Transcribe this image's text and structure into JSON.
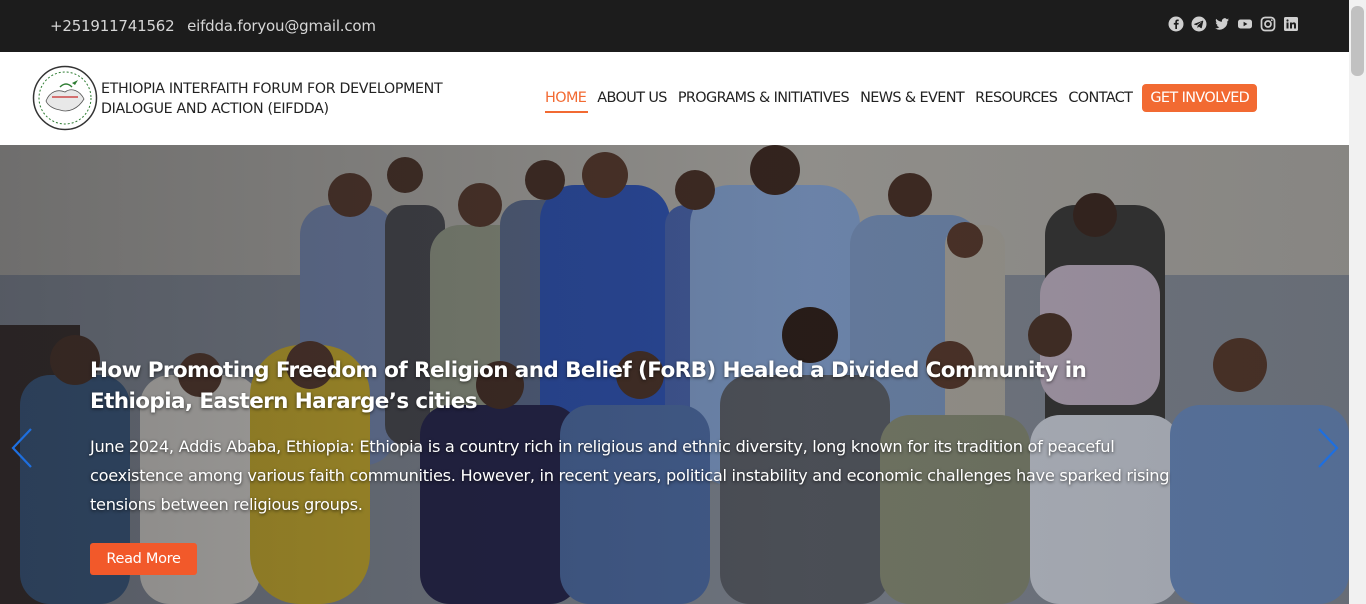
{
  "topbar": {
    "phone": "+251911741562",
    "email": "eifdda.foryou@gmail.com",
    "social_icons": [
      "facebook-icon",
      "telegram-icon",
      "twitter-icon",
      "youtube-icon",
      "instagram-icon",
      "linkedin-icon"
    ]
  },
  "header": {
    "org_name_line1": "ETHIOPIA INTERFAITH FORUM FOR DEVELOPMENT",
    "org_name_line2": "DIALOGUE AND ACTION (EIFDDA)",
    "nav": {
      "home": "HOME",
      "about": "ABOUT US",
      "programs": "PROGRAMS & INITIATIVES",
      "news": "NEWS & EVENT",
      "resources": "RESOURCES",
      "contact": "CONTACT",
      "cta": "GET INVOLVED"
    }
  },
  "hero": {
    "title": "How Promoting Freedom of Religion and Belief (FoRB) Healed a Divided Community in Ethiopia, Eastern Hararge’s cities",
    "text": "June 2024, Addis Ababa, Ethiopia: Ethiopia is a country rich in religious and ethnic diversity, long known for its tradition of peaceful coexistence among various faith communities. However, in recent years, political instability and economic challenges have sparked rising tensions between religious groups.",
    "button": "Read More"
  },
  "colors": {
    "accent": "#f26a32",
    "topbar_bg": "#1c1c1c",
    "arrow": "#1e6fe0"
  }
}
